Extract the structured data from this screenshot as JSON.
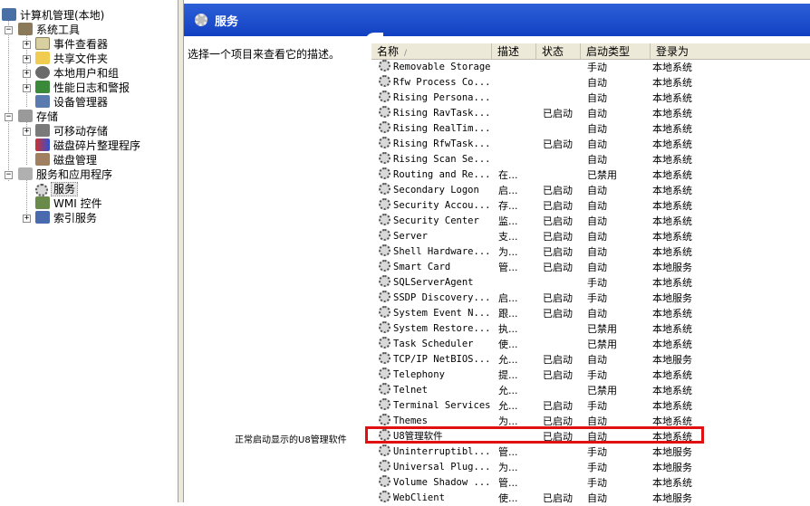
{
  "tree": {
    "root": "计算机管理(本地)",
    "system_tools": "系统工具",
    "event_viewer": "事件查看器",
    "shared_folders": "共享文件夹",
    "local_users": "本地用户和组",
    "perf_logs": "性能日志和警报",
    "device_manager": "设备管理器",
    "storage": "存储",
    "removable_storage": "可移动存储",
    "defrag": "磁盘碎片整理程序",
    "disk_mgmt": "磁盘管理",
    "services_apps": "服务和应用程序",
    "services": "服务",
    "wmi": "WMI 控件",
    "indexing": "索引服务",
    "expand_minus": "−",
    "expand_plus": "+"
  },
  "header": {
    "title": "服务"
  },
  "description_pane": {
    "hint": "选择一个项目来查看它的描述。",
    "annotation": "正常启动显示的U8管理软件"
  },
  "columns": {
    "name": "名称",
    "sort_indicator": "/",
    "description": "描述",
    "status": "状态",
    "startup_type": "启动类型",
    "logon_as": "登录为"
  },
  "rows": [
    {
      "name": "Removable Storage",
      "desc": "",
      "status": "",
      "startup": "手动",
      "logon": "本地系统"
    },
    {
      "name": "Rfw Process Co...",
      "desc": "",
      "status": "",
      "startup": "自动",
      "logon": "本地系统"
    },
    {
      "name": "Rising Persona...",
      "desc": "",
      "status": "",
      "startup": "自动",
      "logon": "本地系统"
    },
    {
      "name": "Rising RavTask...",
      "desc": "",
      "status": "已启动",
      "startup": "自动",
      "logon": "本地系统"
    },
    {
      "name": "Rising RealTim...",
      "desc": "",
      "status": "",
      "startup": "自动",
      "logon": "本地系统"
    },
    {
      "name": "Rising RfwTask...",
      "desc": "",
      "status": "已启动",
      "startup": "自动",
      "logon": "本地系统"
    },
    {
      "name": "Rising Scan Se...",
      "desc": "",
      "status": "",
      "startup": "自动",
      "logon": "本地系统"
    },
    {
      "name": "Routing and Re...",
      "desc": "在...",
      "status": "",
      "startup": "已禁用",
      "logon": "本地系统"
    },
    {
      "name": "Secondary Logon",
      "desc": "启...",
      "status": "已启动",
      "startup": "自动",
      "logon": "本地系统"
    },
    {
      "name": "Security Accou...",
      "desc": "存...",
      "status": "已启动",
      "startup": "自动",
      "logon": "本地系统"
    },
    {
      "name": "Security Center",
      "desc": "监...",
      "status": "已启动",
      "startup": "自动",
      "logon": "本地系统"
    },
    {
      "name": "Server",
      "desc": "支...",
      "status": "已启动",
      "startup": "自动",
      "logon": "本地系统"
    },
    {
      "name": "Shell Hardware...",
      "desc": "为...",
      "status": "已启动",
      "startup": "自动",
      "logon": "本地系统"
    },
    {
      "name": "Smart Card",
      "desc": "管...",
      "status": "已启动",
      "startup": "自动",
      "logon": "本地服务"
    },
    {
      "name": "SQLServerAgent",
      "desc": "",
      "status": "",
      "startup": "手动",
      "logon": "本地系统"
    },
    {
      "name": "SSDP Discovery...",
      "desc": "启...",
      "status": "已启动",
      "startup": "手动",
      "logon": "本地服务"
    },
    {
      "name": "System Event N...",
      "desc": "跟...",
      "status": "已启动",
      "startup": "自动",
      "logon": "本地系统"
    },
    {
      "name": "System Restore...",
      "desc": "执...",
      "status": "",
      "startup": "已禁用",
      "logon": "本地系统"
    },
    {
      "name": "Task Scheduler",
      "desc": "使...",
      "status": "",
      "startup": "已禁用",
      "logon": "本地系统"
    },
    {
      "name": "TCP/IP NetBIOS...",
      "desc": "允...",
      "status": "已启动",
      "startup": "自动",
      "logon": "本地服务"
    },
    {
      "name": "Telephony",
      "desc": "提...",
      "status": "已启动",
      "startup": "手动",
      "logon": "本地系统"
    },
    {
      "name": "Telnet",
      "desc": "允...",
      "status": "",
      "startup": "已禁用",
      "logon": "本地系统"
    },
    {
      "name": "Terminal Services",
      "desc": "允...",
      "status": "已启动",
      "startup": "手动",
      "logon": "本地系统"
    },
    {
      "name": "Themes",
      "desc": "为...",
      "status": "已启动",
      "startup": "自动",
      "logon": "本地系统"
    },
    {
      "name": "U8管理软件",
      "desc": "",
      "status": "已启动",
      "startup": "自动",
      "logon": "本地系统"
    },
    {
      "name": "Uninterruptibl...",
      "desc": "管...",
      "status": "",
      "startup": "手动",
      "logon": "本地服务"
    },
    {
      "name": "Universal Plug...",
      "desc": "为...",
      "status": "",
      "startup": "手动",
      "logon": "本地服务"
    },
    {
      "name": "Volume Shadow ...",
      "desc": "管...",
      "status": "",
      "startup": "手动",
      "logon": "本地系统"
    },
    {
      "name": "WebClient",
      "desc": "使...",
      "status": "已启动",
      "startup": "自动",
      "logon": "本地服务"
    }
  ],
  "colors": {
    "header_blue": "#1141c2",
    "highlight_red": "#e01010"
  }
}
